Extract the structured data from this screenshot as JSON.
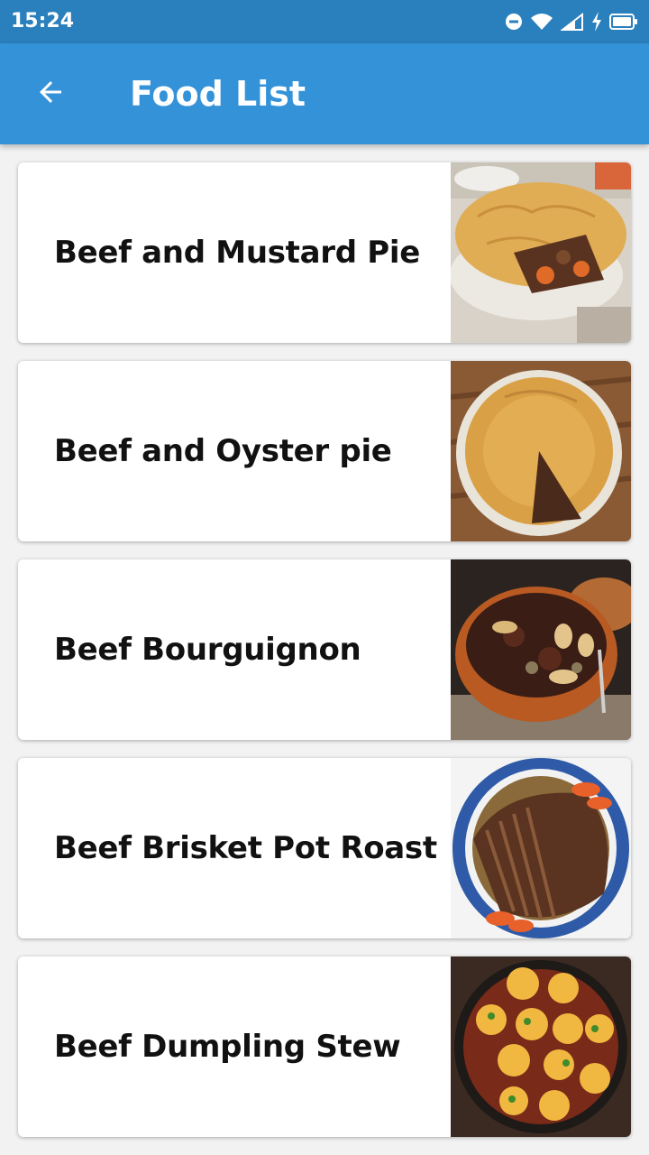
{
  "status_bar": {
    "time": "15:24",
    "icons": [
      "do-not-disturb-icon",
      "wifi-icon",
      "signal-icon",
      "charging-icon",
      "battery-icon"
    ]
  },
  "app_bar": {
    "title": "Food List",
    "back_icon": "arrow-back-icon",
    "color": "#3492d8"
  },
  "foods": [
    {
      "name": "Beef and Mustard Pie",
      "image": "pie-slice-image"
    },
    {
      "name": "Beef and Oyster pie",
      "image": "pie-cut-image"
    },
    {
      "name": "Beef Bourguignon",
      "image": "stew-pot-image"
    },
    {
      "name": "Beef Brisket Pot Roast",
      "image": "brisket-platter-image"
    },
    {
      "name": "Beef Dumpling Stew",
      "image": "dumpling-stew-image"
    }
  ]
}
